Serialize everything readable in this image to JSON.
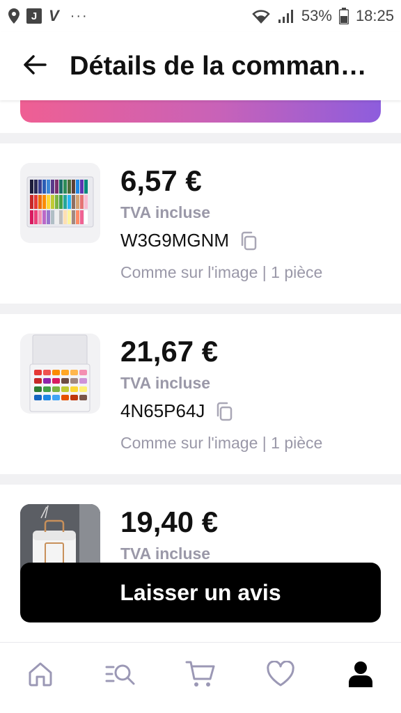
{
  "status_bar": {
    "battery": "53%",
    "time": "18:25",
    "box_icon_letter": "J",
    "v_icon_letter": "V",
    "more_dots": "···"
  },
  "header": {
    "title": "Détails de la comman…"
  },
  "products": [
    {
      "price": "6,57 €",
      "tva": "TVA incluse",
      "sku": "W3G9MGNM",
      "variant": "Comme sur l'image | 1 pièce"
    },
    {
      "price": "21,67 €",
      "tva": "TVA incluse",
      "sku": "4N65P64J",
      "variant": "Comme sur l'image | 1 pièce"
    },
    {
      "price": "19,40 €",
      "tva": "TVA incluse"
    }
  ],
  "review_button": {
    "label": "Laisser un avis"
  },
  "bottom_nav": {
    "items": [
      "home-icon",
      "search-list-icon",
      "cart-icon",
      "heart-icon",
      "profile-icon"
    ],
    "active": "profile-icon",
    "inactive_color": "#9b98b5",
    "active_color": "#000000"
  },
  "colors": {
    "gradient_start": "#ef5f93",
    "gradient_end": "#8d5ddd",
    "muted_text": "#9a98a8"
  }
}
